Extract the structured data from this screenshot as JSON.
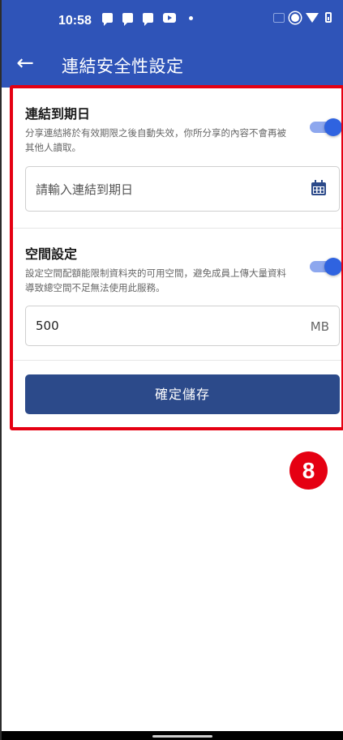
{
  "status_bar": {
    "time": "10:58"
  },
  "app_bar": {
    "back_icon": "←",
    "title": "連結安全性設定"
  },
  "link_expiry": {
    "title": "連結到期日",
    "description": "分享連結將於有效期限之後自動失效，你所分享的內容不會再被其他人讀取。",
    "toggle_on": true,
    "input_placeholder": "請輸入連結到期日",
    "calendar_icon": "calendar-icon"
  },
  "space_setting": {
    "title": "空間設定",
    "description": "設定空間配額能限制資料夾的可用空間，避免成員上傳大量資料導致總空間不足無法使用此服務。",
    "toggle_on": true,
    "value": "500",
    "unit": "MB"
  },
  "save_button": {
    "label": "確定儲存"
  },
  "annotation_badge": {
    "number": "8"
  },
  "colors": {
    "primary": "#2f54b8",
    "button": "#2c4a8a",
    "highlight": "#e50012",
    "toggle": "#2f63e0"
  }
}
